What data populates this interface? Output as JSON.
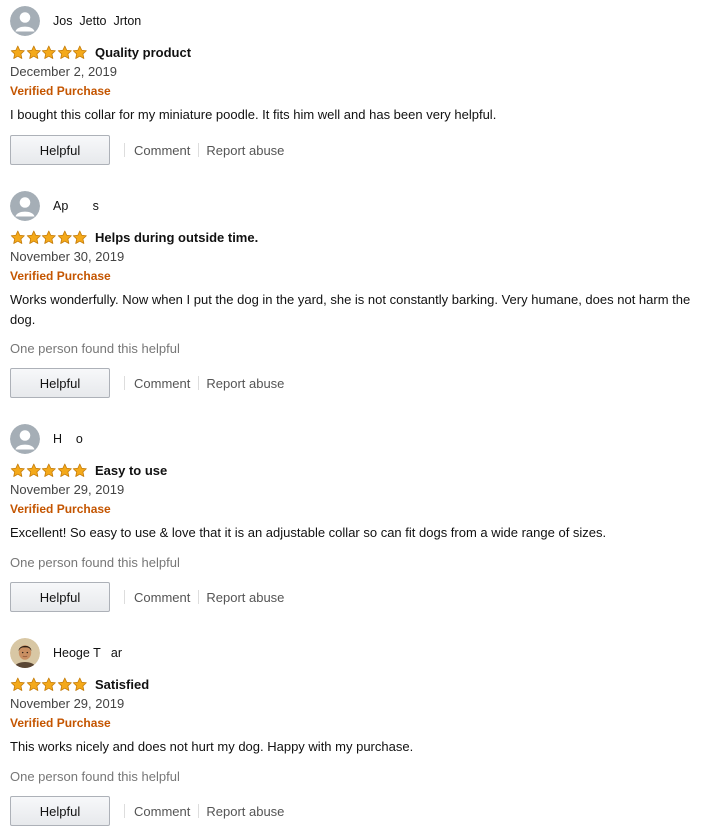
{
  "reviews": [
    {
      "reviewer": "Jos  Jetto  Jrton",
      "avatar": "default-avatar",
      "rating": 5,
      "title": "Quality product",
      "date": "December 2, 2019",
      "verified": "Verified Purchase",
      "body": "I bought this collar for my miniature poodle. It fits him well and has been very helpful.",
      "helpful_count": "",
      "helpful_label": "Helpful",
      "comment_label": "Comment",
      "report_label": "Report abuse"
    },
    {
      "reviewer": "Ap       s",
      "avatar": "default-avatar",
      "rating": 5,
      "title": "Helps during outside time.",
      "date": "November 30, 2019",
      "verified": "Verified Purchase",
      "body": "Works wonderfully. Now when I put the dog in the yard, she is not constantly barking. Very humane, does not harm the dog.",
      "helpful_count": "One person found this helpful",
      "helpful_label": "Helpful",
      "comment_label": "Comment",
      "report_label": "Report abuse"
    },
    {
      "reviewer": "H    o",
      "avatar": "default-avatar",
      "rating": 5,
      "title": "Easy to use",
      "date": "November 29, 2019",
      "verified": "Verified Purchase",
      "body": "Excellent! So easy to use & love that it is an adjustable collar so can fit dogs from a wide range of sizes.",
      "helpful_count": "One person found this helpful",
      "helpful_label": "Helpful",
      "comment_label": "Comment",
      "report_label": "Report abuse"
    },
    {
      "reviewer": "Heoge T   ar",
      "avatar": "photo-avatar",
      "rating": 5,
      "title": "Satisfied",
      "date": "November 29, 2019",
      "verified": "Verified Purchase",
      "body": "This works nicely and does not hurt my dog. Happy with my purchase.",
      "helpful_count": "One person found this helpful",
      "helpful_label": "Helpful",
      "comment_label": "Comment",
      "report_label": "Report abuse"
    }
  ],
  "colors": {
    "star": "#f4a91a",
    "star_outline": "#c47c0b",
    "verified": "#c45500",
    "muted_text": "#777777"
  }
}
